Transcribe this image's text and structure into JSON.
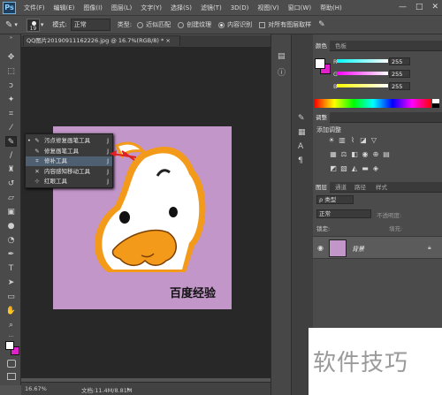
{
  "app": {
    "logo": "Ps",
    "window_controls": [
      "—",
      "□",
      "✕"
    ]
  },
  "menu": [
    "文件(F)",
    "编辑(E)",
    "图像(I)",
    "图层(L)",
    "文字(Y)",
    "选择(S)",
    "滤镜(T)",
    "3D(D)",
    "视图(V)",
    "窗口(W)",
    "帮助(H)"
  ],
  "options": {
    "brush_size": "19",
    "mode_label": "模式:",
    "mode_value": "正常",
    "type_label": "类型:",
    "type_options": [
      "近似匹配",
      "创建纹理",
      "内容识别"
    ],
    "type_selected": 2,
    "sample_all_layers": "对所有图层取样"
  },
  "document": {
    "tab_title": "QQ图片20190911162226.jpg @ 16.7%(RGB/8) *",
    "tab_close": "×",
    "zoom": "16.67%",
    "doc_info": "文档:11.4M/8.81M",
    "canvas_caption": "百度经验"
  },
  "tool_flyout": {
    "items": [
      {
        "icon": "spot-healing-icon",
        "label": "污点修复画笔工具",
        "shortcut": "J"
      },
      {
        "icon": "healing-brush-icon",
        "label": "修复画笔工具",
        "shortcut": "J"
      },
      {
        "icon": "patch-icon",
        "label": "修补工具",
        "shortcut": "J"
      },
      {
        "icon": "content-aware-move-icon",
        "label": "内容感知移动工具",
        "shortcut": "J"
      },
      {
        "icon": "red-eye-icon",
        "label": "红眼工具",
        "shortcut": "J"
      }
    ],
    "highlighted": 2,
    "current": 0
  },
  "color_panel": {
    "tabs": [
      "颜色",
      "色板"
    ],
    "channels": [
      {
        "label": "R",
        "value": "255"
      },
      {
        "label": "G",
        "value": "255"
      },
      {
        "label": "B",
        "value": "255"
      }
    ]
  },
  "adjustments_panel": {
    "tab": "调整",
    "title": "添加调整"
  },
  "layers_panel": {
    "tabs": [
      "图层",
      "通道",
      "路径",
      "样式"
    ],
    "filter_label": "ρ 类型",
    "blend_mode": "正常",
    "opacity_label": "不透明度:",
    "lock_label": "锁定:",
    "fill_label": "填充:",
    "layer_name": "背景"
  },
  "watermark": "软件技巧",
  "colors": {
    "canvas_bg": "#c396c9",
    "foreground": "#ffffff",
    "background": "#e020c8",
    "duck_orange": "#f39a1a",
    "flyout_highlight": "#4e5f72"
  }
}
